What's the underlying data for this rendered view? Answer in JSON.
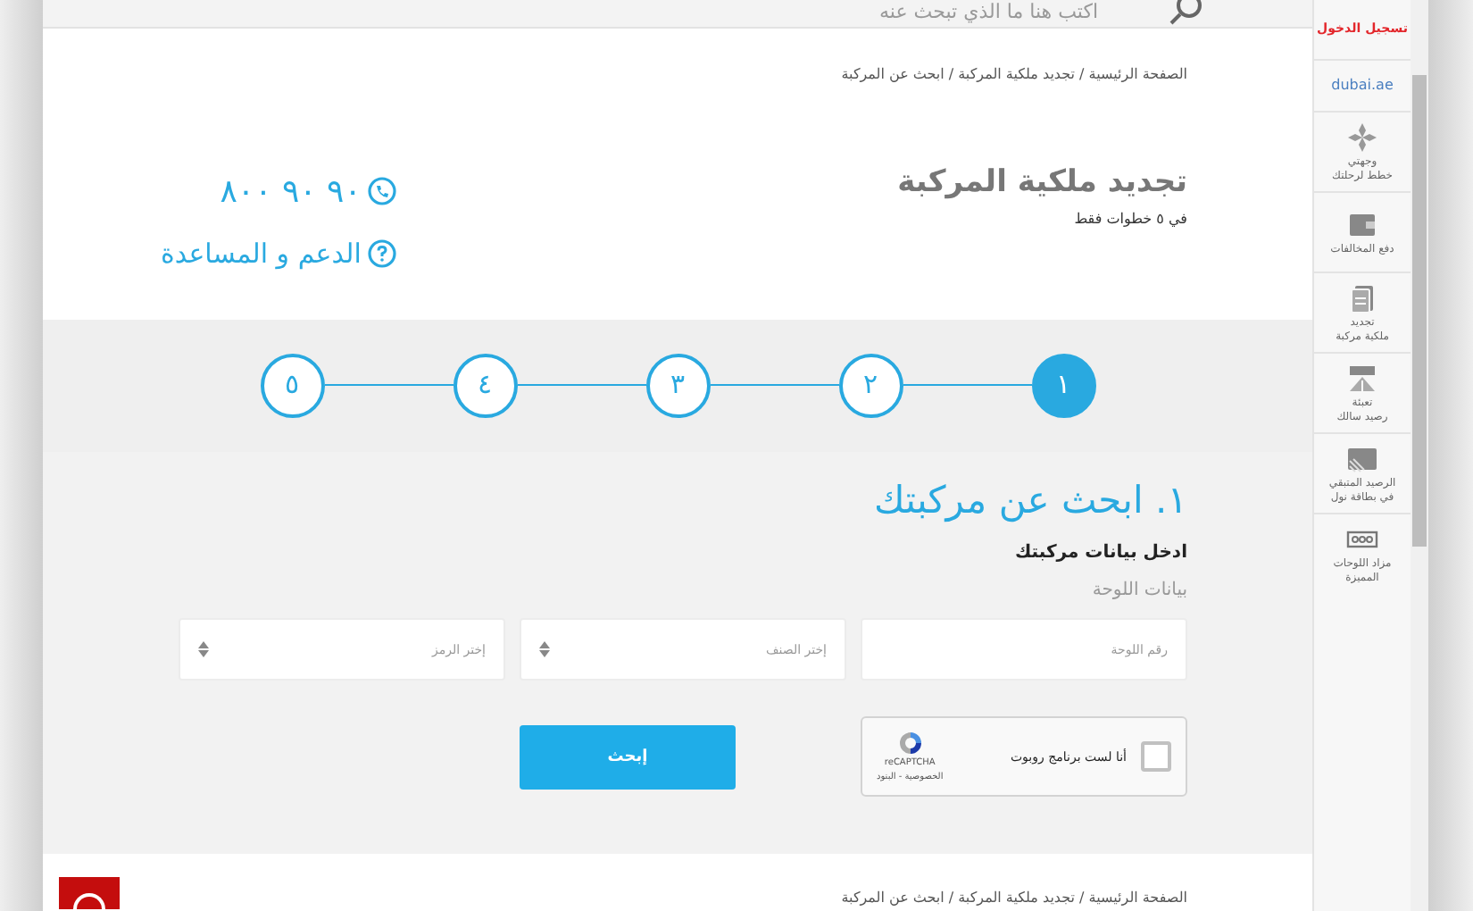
{
  "search": {
    "placeholder": "اكتب هنا ما الذي تبحث عنه"
  },
  "breadcrumb": "الصفحة الرئيسية / تجديد ملكية المركبة / ابحث عن المركبة",
  "page_title": "تجديد ملكية المركبة",
  "subtitle": "في ٥ خطوات فقط",
  "phone": "٨٠٠ ٩٠ ٩٠",
  "support": "الدعم و المساعدة",
  "steps": [
    {
      "label": "١",
      "selected": true
    },
    {
      "label": "٢",
      "selected": false
    },
    {
      "label": "٣",
      "selected": false
    },
    {
      "label": "٤",
      "selected": false
    },
    {
      "label": "٥",
      "selected": false
    }
  ],
  "form": {
    "heading": "١. ابحث عن مركبتك",
    "intro": "ادخل بيانات مركبتك",
    "section": "بيانات اللوحة",
    "fields": [
      {
        "kind": "text",
        "placeholder": "رقم اللوحة"
      },
      {
        "kind": "select",
        "placeholder": "إختر الصنف"
      },
      {
        "kind": "select",
        "placeholder": "إختر الرمز"
      }
    ],
    "captcha": {
      "label": "أنا لست برنامج روبوت",
      "checked": false,
      "brand": "reCAPTCHA",
      "links": "الخصوصية - البنود"
    },
    "button": "إبحث"
  },
  "footer_breadcrumb": "الصفحة الرئيسية / تجديد ملكية المركبة / ابحث عن المركبة",
  "sidebar": {
    "login": "تسجيل الدخول",
    "logo": "dubai.ae",
    "items": [
      {
        "kind": "compass",
        "lines": [
          "وجهتي",
          "خطط لرحلتك"
        ]
      },
      {
        "kind": "wallet",
        "lines": [
          "دفع المخالفات"
        ]
      },
      {
        "kind": "document",
        "lines": [
          "تجديد",
          "ملكية مركبة"
        ]
      },
      {
        "kind": "toll",
        "lines": [
          "تعبئة",
          "رصيد سالك"
        ]
      },
      {
        "kind": "card",
        "lines": [
          "الرصيد المتبقي",
          "في بطاقة نول"
        ]
      },
      {
        "kind": "plate",
        "lines": [
          "مزاد اللوحات",
          "المميزة"
        ]
      }
    ]
  }
}
